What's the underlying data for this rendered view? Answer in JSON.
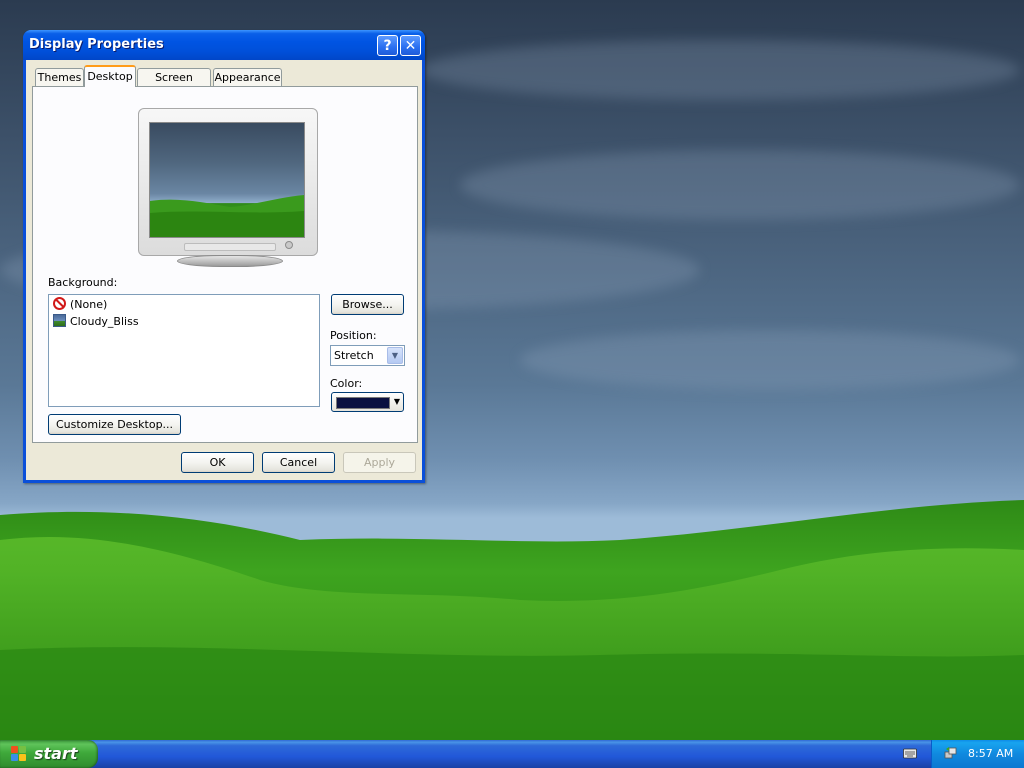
{
  "dialog": {
    "title": "Display Properties",
    "help_label": "?",
    "close_label": "✕",
    "tabs": [
      {
        "label": "Themes",
        "active": false
      },
      {
        "label": "Desktop",
        "active": true
      },
      {
        "label": "Screen Saver",
        "active": false
      },
      {
        "label": "Appearance",
        "active": false
      }
    ],
    "background_label": "Background:",
    "background_items": [
      {
        "label": "(None)",
        "icon": "none-icon"
      },
      {
        "label": "Cloudy_Bliss",
        "icon": "image-file-icon"
      }
    ],
    "browse_label": "Browse...",
    "position_label": "Position:",
    "position_value": "Stretch",
    "color_label": "Color:",
    "color_value": "#0a1040",
    "customize_label": "Customize Desktop...",
    "ok_label": "OK",
    "cancel_label": "Cancel",
    "apply_label": "Apply",
    "apply_enabled": false
  },
  "taskbar": {
    "start_label": "start",
    "clock": "8:57 AM"
  }
}
